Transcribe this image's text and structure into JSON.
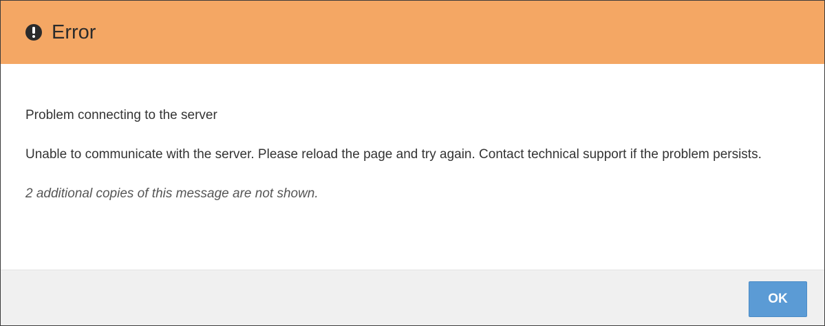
{
  "dialog": {
    "title": "Error",
    "icon": "exclamation-circle-icon",
    "header_color": "#f4a764",
    "heading": "Problem connecting to the server",
    "message": "Unable to communicate with the server. Please reload the page and try again. Contact technical support if the problem persists.",
    "note": "2 additional copies of this message are not shown."
  },
  "footer": {
    "ok_label": "OK",
    "button_color": "#5b9bd5"
  }
}
